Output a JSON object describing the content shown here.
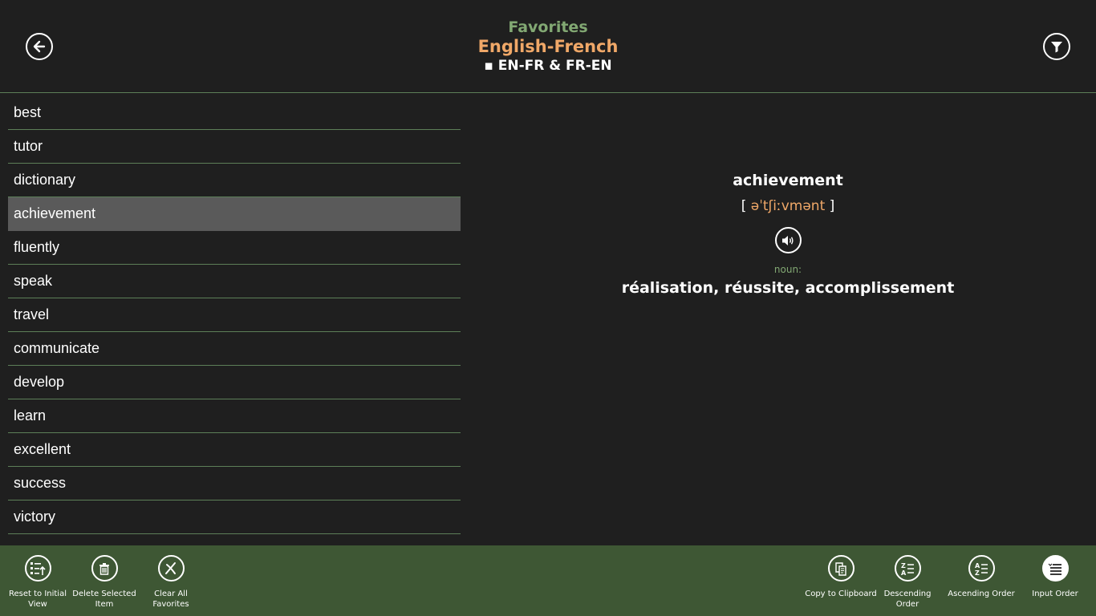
{
  "header": {
    "section": "Favorites",
    "dictionary": "English-French",
    "direction": "▪ EN-FR & FR-EN",
    "back_icon": "back-arrow-icon",
    "filter_icon": "filter-icon"
  },
  "words": [
    {
      "text": "best",
      "selected": false
    },
    {
      "text": "tutor",
      "selected": false
    },
    {
      "text": "dictionary",
      "selected": false
    },
    {
      "text": "achievement",
      "selected": true
    },
    {
      "text": "fluently",
      "selected": false
    },
    {
      "text": "speak",
      "selected": false
    },
    {
      "text": "travel",
      "selected": false
    },
    {
      "text": "communicate",
      "selected": false
    },
    {
      "text": "develop",
      "selected": false
    },
    {
      "text": "learn",
      "selected": false
    },
    {
      "text": "excellent",
      "selected": false
    },
    {
      "text": "success",
      "selected": false
    },
    {
      "text": "victory",
      "selected": false
    }
  ],
  "detail": {
    "word": "achievement",
    "bracket_open": "[ ",
    "pronunciation": "əˈtʃiːvmənt",
    "bracket_close": " ]",
    "part_of_speech": "noun:",
    "translation": "réalisation, réussite, accomplissement"
  },
  "appbar": {
    "reset_label": "Reset to Initial View",
    "delete_label": "Delete Selected Item",
    "clear_label": "Clear All Favorites",
    "copy_label": "Copy to Clipboard",
    "descending_label": "Descending Order",
    "ascending_label": "Ascending Order",
    "input_label": "Input Order"
  },
  "colors": {
    "background": "#1f1f1f",
    "accent_green": "#82a873",
    "accent_orange": "#f0a868",
    "appbar": "#3e5734",
    "divider": "#5d7f58",
    "selected_row": "#5a5a5a"
  }
}
